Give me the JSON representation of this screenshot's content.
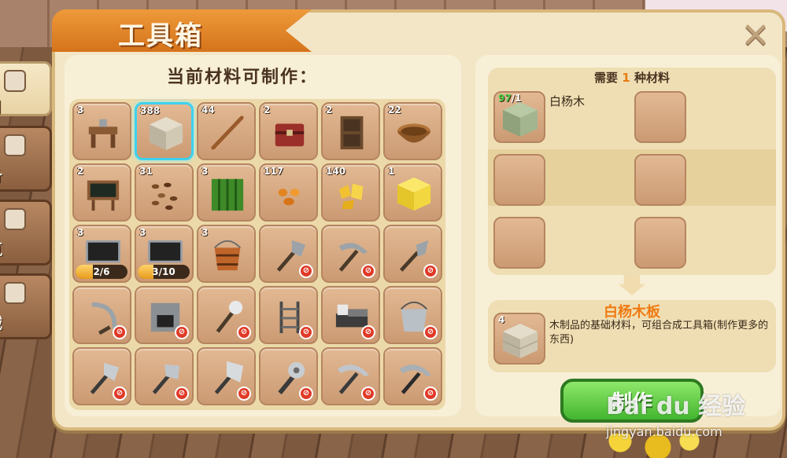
{
  "window": {
    "title": "工具箱",
    "close_icon": "close-icon"
  },
  "side_tabs": [
    {
      "label": "用",
      "icon": "backpack-icon",
      "active": true
    },
    {
      "label": "备",
      "icon": "armor-icon",
      "active": false
    },
    {
      "label": "筑",
      "icon": "house-icon",
      "active": false
    },
    {
      "label": "械",
      "icon": "gear-icon",
      "active": false
    }
  ],
  "recipes": {
    "heading": "当前材料可制作：",
    "items": [
      {
        "count": "3",
        "icon": "workbench-icon",
        "locked": false
      },
      {
        "count": "388",
        "icon": "birch-plank-block-icon",
        "locked": false,
        "selected": true
      },
      {
        "count": "44",
        "icon": "stick-icon",
        "locked": false
      },
      {
        "count": "2",
        "icon": "chest-icon",
        "locked": false
      },
      {
        "count": "2",
        "icon": "door-icon",
        "locked": false
      },
      {
        "count": "22",
        "icon": "wooden-bowl-icon",
        "locked": false
      },
      {
        "count": "2",
        "icon": "signboard-icon",
        "locked": false
      },
      {
        "count": "31",
        "icon": "seeds-icon",
        "locked": false
      },
      {
        "count": "3",
        "icon": "watermelon-icon",
        "locked": false
      },
      {
        "count": "117",
        "icon": "orange-pebbles-icon",
        "locked": false
      },
      {
        "count": "140",
        "icon": "gold-nuggets-icon",
        "locked": false
      },
      {
        "count": "1",
        "icon": "gold-block-icon",
        "locked": false
      },
      {
        "count": "3",
        "icon": "blackboard-icon",
        "locked": false,
        "progress_text": "2/6",
        "progress": 0.33
      },
      {
        "count": "3",
        "icon": "blackboard-icon",
        "locked": false,
        "progress_text": "3/10",
        "progress": 0.3
      },
      {
        "count": "3",
        "icon": "wooden-bucket-icon",
        "locked": false
      },
      {
        "count": "",
        "icon": "stone-axe-icon",
        "locked": true
      },
      {
        "count": "",
        "icon": "stone-pickaxe-icon",
        "locked": true
      },
      {
        "count": "",
        "icon": "stone-shovel-icon",
        "locked": true
      },
      {
        "count": "",
        "icon": "sickle-icon",
        "locked": true
      },
      {
        "count": "",
        "icon": "furnace-icon",
        "locked": true
      },
      {
        "count": "",
        "icon": "torch-icon",
        "locked": true
      },
      {
        "count": "",
        "icon": "ladder-icon",
        "locked": true
      },
      {
        "count": "",
        "icon": "bed-icon",
        "locked": true
      },
      {
        "count": "",
        "icon": "iron-bucket-icon",
        "locked": true
      },
      {
        "count": "",
        "icon": "iron-axe-icon",
        "locked": true
      },
      {
        "count": "",
        "icon": "hatchet-icon",
        "locked": true
      },
      {
        "count": "",
        "icon": "broad-axe-icon",
        "locked": true
      },
      {
        "count": "",
        "icon": "saw-blade-icon",
        "locked": true
      },
      {
        "count": "",
        "icon": "iron-pickaxe-icon",
        "locked": true
      },
      {
        "count": "",
        "icon": "steel-pickaxe-icon",
        "locked": true
      }
    ]
  },
  "materials": {
    "heading_prefix": "需要",
    "heading_count": "1",
    "heading_suffix": "种材料",
    "item": {
      "have": "97",
      "need": "/1",
      "name": "白杨木",
      "icon": "birch-log-icon"
    }
  },
  "result": {
    "title": "白杨木板",
    "count": "4",
    "icon": "birch-plank-block-icon",
    "description": "木制品的基础材料，可组合成工具箱(制作更多的东西)"
  },
  "craft_button": {
    "label": "制作"
  },
  "watermark": {
    "text": "Bai du 经验",
    "url": "jingyan.baidu.com"
  },
  "colors": {
    "accent": "#f07a12",
    "selected": "#3fd1f0",
    "craft": "#43b52f",
    "locked": "#e03a28"
  }
}
